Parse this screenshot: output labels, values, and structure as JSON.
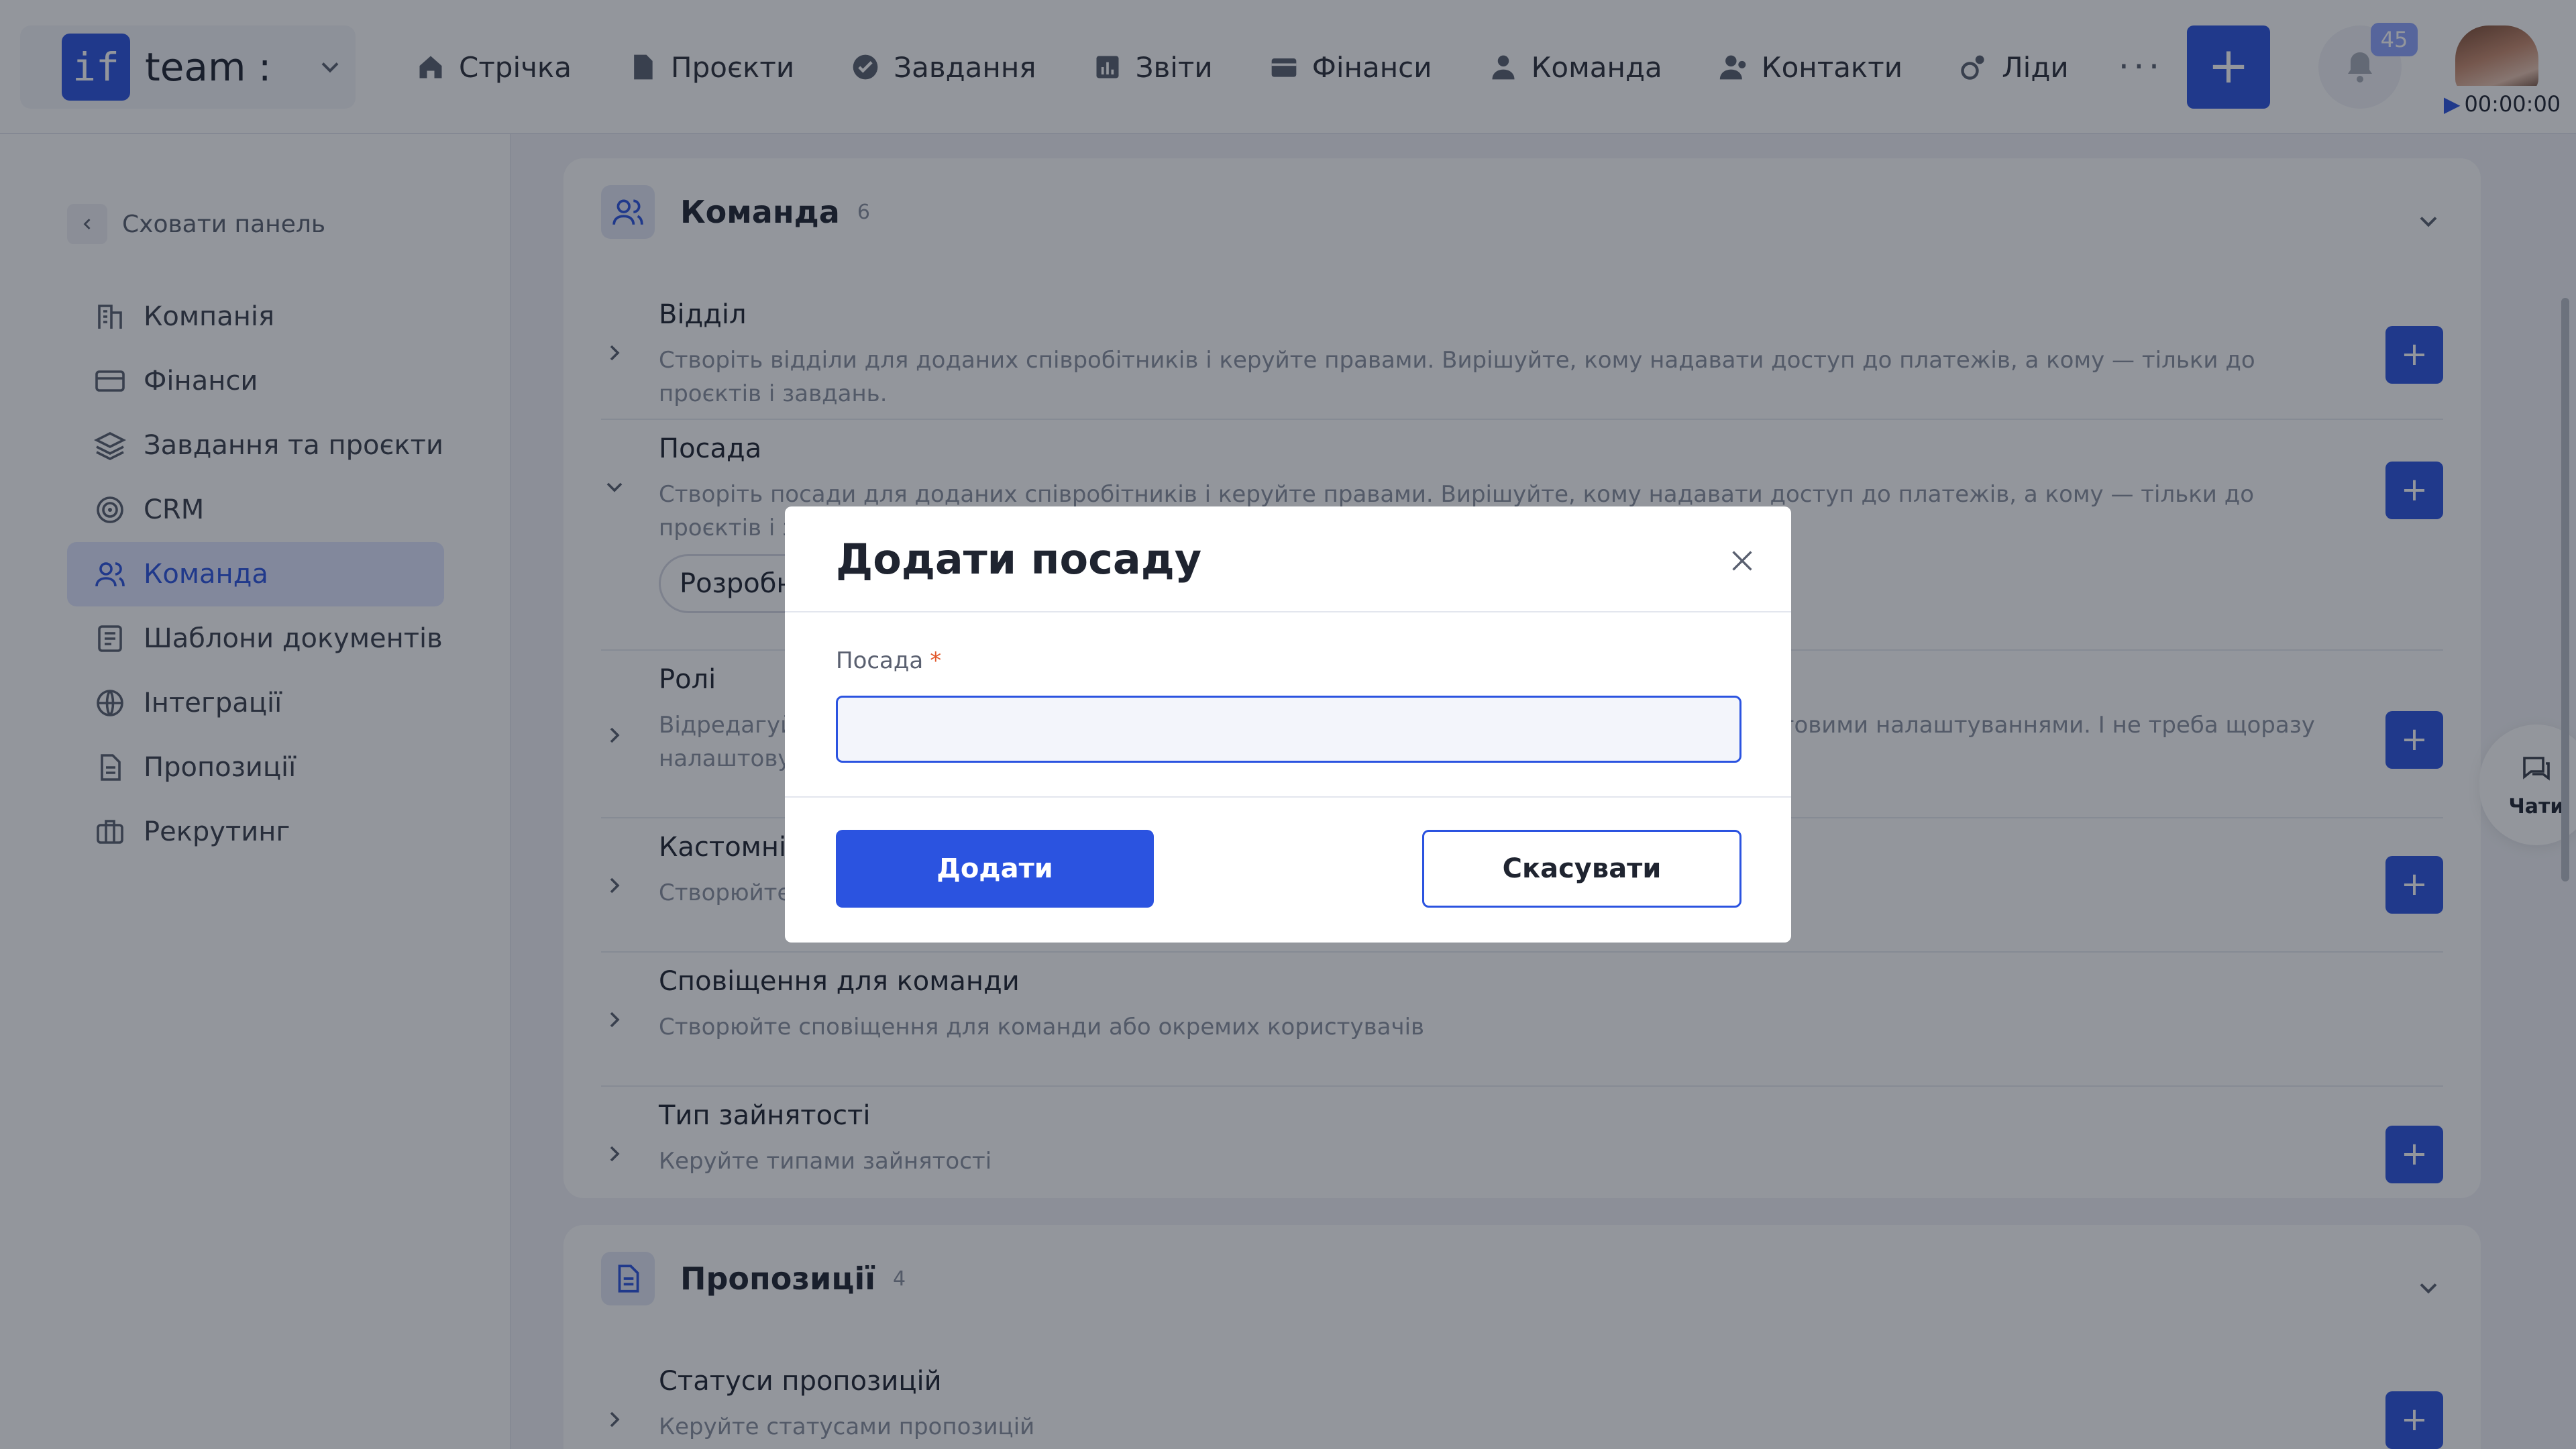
{
  "brand": {
    "logo_text": "if",
    "name": "team :"
  },
  "nav": [
    {
      "label": "Стрічка",
      "icon": "home-icon"
    },
    {
      "label": "Проєкти",
      "icon": "file-icon"
    },
    {
      "label": "Завдання",
      "icon": "check-circle-icon"
    },
    {
      "label": "Звіти",
      "icon": "report-icon"
    },
    {
      "label": "Фінанси",
      "icon": "wallet-icon"
    },
    {
      "label": "Команда",
      "icon": "user-icon"
    },
    {
      "label": "Контакти",
      "icon": "contacts-icon"
    },
    {
      "label": "Ліди",
      "icon": "leads-icon"
    }
  ],
  "nav_more": "···",
  "header": {
    "add_label": "+",
    "notifications_count": "45",
    "timer": "00:00:00"
  },
  "sidebar": {
    "hide_label": "Сховати панель",
    "items": [
      {
        "label": "Компанія",
        "icon": "company-icon"
      },
      {
        "label": "Фінанси",
        "icon": "card-icon"
      },
      {
        "label": "Завдання та проєкти",
        "icon": "layers-icon"
      },
      {
        "label": "CRM",
        "icon": "target-icon"
      },
      {
        "label": "Команда",
        "icon": "team-icon",
        "active": true
      },
      {
        "label": "Шаблони документів",
        "icon": "doc-template-icon"
      },
      {
        "label": "Інтеграції",
        "icon": "globe-icon"
      },
      {
        "label": "Пропозиції",
        "icon": "document-icon"
      },
      {
        "label": "Рекрутинг",
        "icon": "briefcase-icon"
      }
    ]
  },
  "team_section": {
    "title": "Команда",
    "count": "6",
    "rows": [
      {
        "title": "Відділ",
        "desc": "Створіть відділи для доданих співробітників і керуйте правами. Вирішуйте, кому надавати доступ до платежів, а кому — тільки до проєктів і завдань."
      },
      {
        "title": "Посада",
        "desc": "Створіть посади для доданих співробітників і керуйте правами. Вирішуйте, кому надавати доступ до платежів, а кому — тільки до проєктів і завдань.",
        "chip": "Розробн"
      },
      {
        "title": "Ролі",
        "desc_left": "Відредагуй",
        "desc_left2": "налаштову",
        "desc_right": "готовими налаштуваннями. І не треба щоразу"
      },
      {
        "title": "Кастомні",
        "desc": "Створюйте"
      },
      {
        "title": "Сповіщення для команди",
        "desc": "Створюйте сповіщення для команди або окремих користувачів"
      },
      {
        "title": "Тип зайнятості",
        "desc": "Керуйте типами зайнятості"
      }
    ]
  },
  "proposals_section": {
    "title": "Пропозиції",
    "count": "4",
    "rows": [
      {
        "title": "Статуси пропозицій",
        "desc": "Керуйте статусами пропозицій"
      }
    ]
  },
  "chat": {
    "label": "Чати"
  },
  "modal": {
    "title": "Додати посаду",
    "field_label": "Посада",
    "required_mark": "*",
    "field_value": "",
    "submit_label": "Додати",
    "cancel_label": "Скасувати"
  },
  "colors": {
    "primary": "#2b53e0",
    "overlay": "rgba(20,26,40,0.46)",
    "active_bg": "#dfe5ff"
  }
}
